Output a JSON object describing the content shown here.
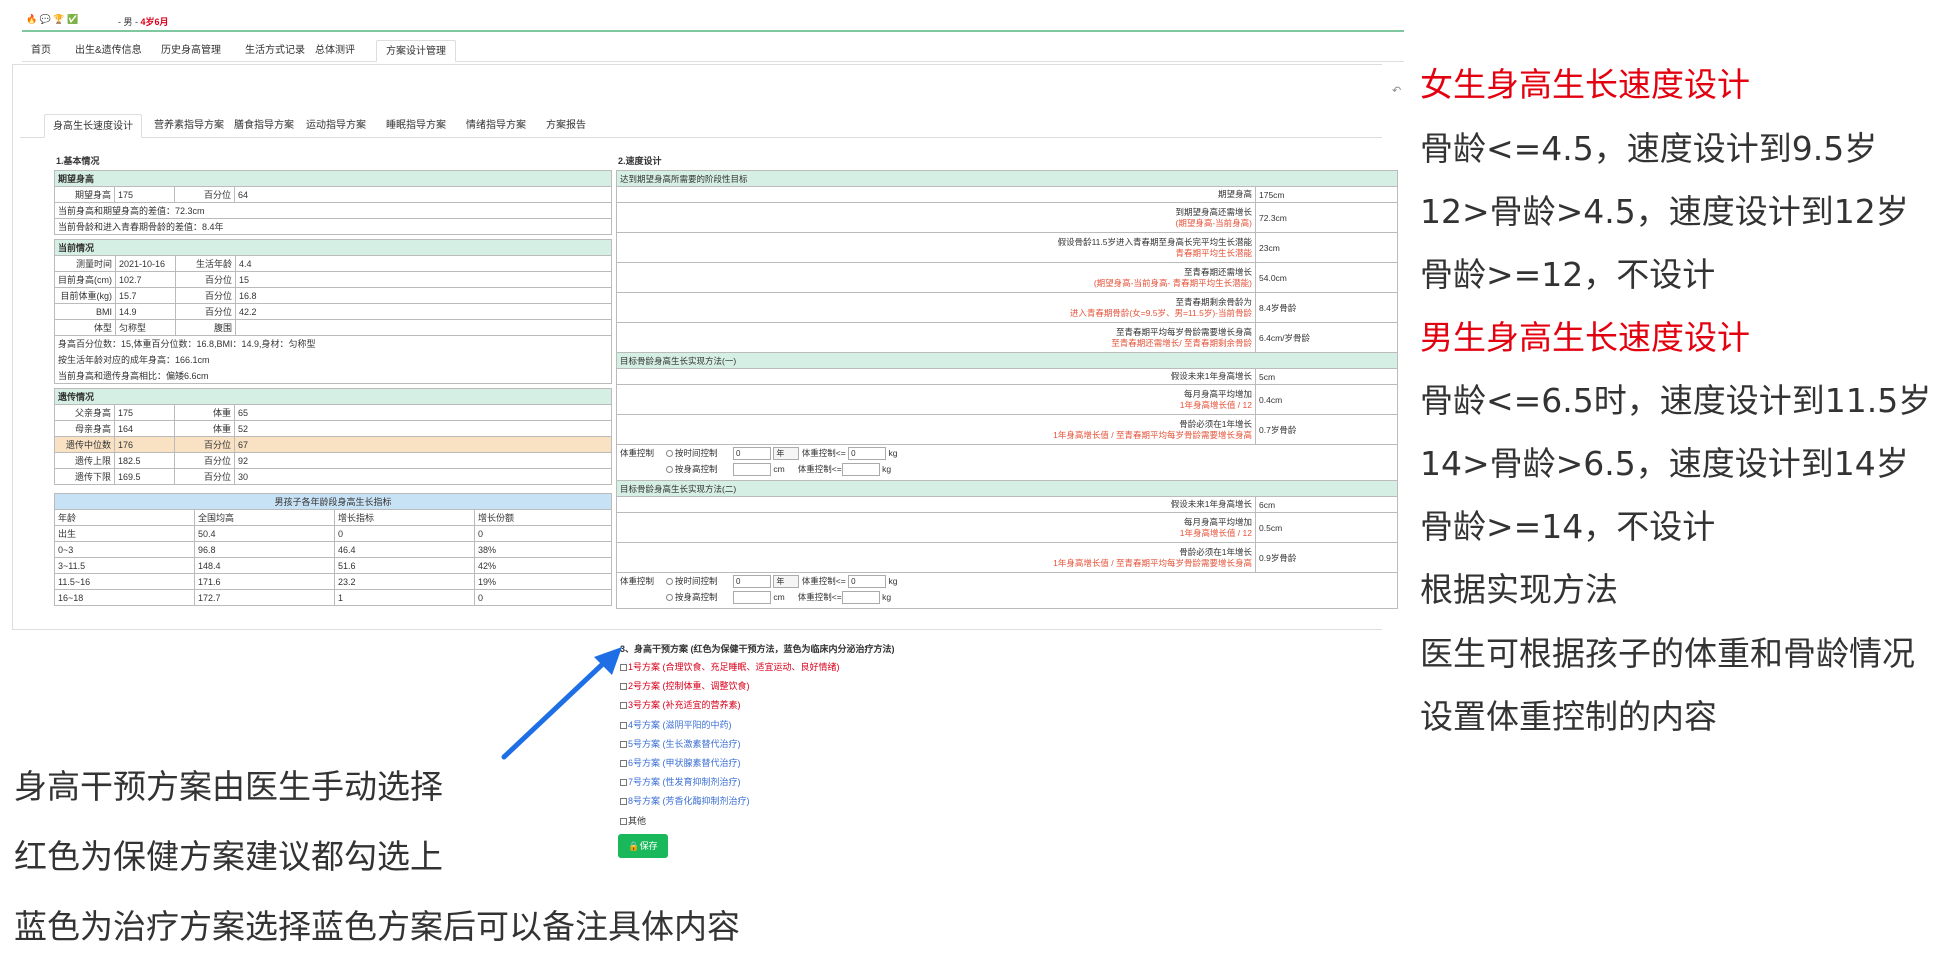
{
  "header": {
    "icons": "🔥 💬 🏆 ✅",
    "title": "- 男 -",
    "age": "4岁6月"
  },
  "main_tabs": [
    "首页",
    "出生&遗传信息",
    "历史身高管理",
    "生活方式记录",
    "总体测评",
    "方案设计管理"
  ],
  "sub_tabs": [
    "身高生长速度设计",
    "营养素指导方案",
    "膳食指导方案",
    "运动指导方案",
    "睡眠指导方案",
    "情绪指导方案",
    "方案报告"
  ],
  "left": {
    "section_title": "1.基本情况",
    "expect": {
      "hd": "期望身高",
      "height_label": "期望身高",
      "height_val": "175",
      "pct_label": "百分位",
      "pct_val": "64",
      "line1": "当前身高和期望身高的差值：72.3cm",
      "line2": "当前骨龄和进入青春期骨龄的差值：8.4年"
    },
    "current": {
      "hd": "当前情况",
      "rows": [
        [
          "测量时间",
          "2021-10-16",
          "生活年龄",
          "4.4"
        ],
        [
          "目前身高(cm)",
          "102.7",
          "百分位",
          "15"
        ],
        [
          "目前体重(kg)",
          "15.7",
          "百分位",
          "16.8"
        ],
        [
          "BMI",
          "14.9",
          "百分位",
          "42.2"
        ],
        [
          "体型",
          "匀称型",
          "腹围",
          ""
        ]
      ],
      "line1": "身高百分位数：15,体重百分位数：16.8,BMI：14.9,身材：匀称型",
      "line2": "按生活年龄对应的成年身高：166.1cm",
      "line3": "当前身高和遗传身高相比：偏矮6.6cm"
    },
    "genetic": {
      "hd": "遗传情况",
      "rows": [
        [
          "父亲身高",
          "175",
          "体重",
          "65"
        ],
        [
          "母亲身高",
          "164",
          "体重",
          "52"
        ],
        [
          "遗传中位数",
          "176",
          "百分位",
          "67"
        ],
        [
          "遗传上限",
          "182.5",
          "百分位",
          "92"
        ],
        [
          "遗传下限",
          "169.5",
          "百分位",
          "30"
        ]
      ]
    },
    "growth": {
      "hd": "男孩子各年龄段身高生长指标",
      "cols": [
        "年龄",
        "全国均高",
        "增长指标",
        "增长份额"
      ],
      "rows": [
        [
          "出生",
          "50.4",
          "0",
          "0"
        ],
        [
          "0~3",
          "96.8",
          "46.4",
          "38%"
        ],
        [
          "3~11.5",
          "148.4",
          "51.6",
          "42%"
        ],
        [
          "11.5~16",
          "171.6",
          "23.2",
          "19%"
        ],
        [
          "16~18",
          "172.7",
          "1",
          "0"
        ]
      ]
    }
  },
  "right": {
    "section_title": "2.速度设计",
    "stage_hd": "达到期望身高所需要的阶段性目标",
    "stage_rows": [
      {
        "l": "期望身高",
        "n": "",
        "v": "175cm"
      },
      {
        "l": "到期望身高还需增长",
        "n": "(期望身高-当前身高)",
        "v": "72.3cm"
      },
      {
        "l": "假设骨龄11.5岁进入青春期至身高长完平均生长潜能",
        "n": "青春期平均生长潜能",
        "v": "23cm"
      },
      {
        "l": "至青春期还需增长",
        "n": "(期望身高-当前身高- 青春期平均生长潜能)",
        "v": "54.0cm"
      },
      {
        "l": "至青春期剩余骨龄为",
        "n": "进入青春期骨龄(女=9.5岁、男=11.5岁)-当前骨龄",
        "v": "8.4岁骨龄"
      },
      {
        "l": "至青春期平均每岁骨龄需要增长身高",
        "n": "至青春期还需增长/ 至青春期剩余骨龄",
        "v": "6.4cm/岁骨龄"
      }
    ],
    "m1_hd": "目标骨龄身高生长实现方法(一)",
    "m1_rows": [
      {
        "l": "假设未来1年身高增长",
        "n": "",
        "v": "5cm"
      },
      {
        "l": "每月身高平均增加",
        "n": "1年身高增长值 / 12",
        "v": "0.4cm"
      },
      {
        "l": "骨龄必须在1年增长",
        "n": "1年身高增长值 / 至青春期平均每岁骨龄需要增长身高",
        "v": "0.7岁骨龄"
      }
    ],
    "m2_hd": "目标骨龄身高生长实现方法(二)",
    "m2_rows": [
      {
        "l": "假设未来1年身高增长",
        "n": "",
        "v": "6cm"
      },
      {
        "l": "每月身高平均增加",
        "n": "1年身高增长值 / 12",
        "v": "0.5cm"
      },
      {
        "l": "骨龄必须在1年增长",
        "n": "1年身高增长值 / 至青春期平均每岁骨龄需要增长身高",
        "v": "0.9岁骨龄"
      }
    ],
    "wc": {
      "label": "体重控制",
      "opt1": "按时间控制",
      "opt2": "按身高控制",
      "v": "0",
      "unit_sel": "年",
      "kg_label": "体重控制<=",
      "kg": "kg",
      "cm": "cm"
    }
  },
  "plans": {
    "title": "3、身高干预方案 (红色为保健干预方法，蓝色为临床内分泌治疗方法)",
    "items": [
      {
        "t": "1号方案 (合理饮食、充足睡眠、适宜运动、良好情绪)",
        "c": "red"
      },
      {
        "t": "2号方案 (控制体重、调整饮食)",
        "c": "red"
      },
      {
        "t": "3号方案 (补充适宜的营养素)",
        "c": "red"
      },
      {
        "t": "4号方案 (滋阴平阳的中药)",
        "c": "blue"
      },
      {
        "t": "5号方案 (生长激素替代治疗)",
        "c": "blue"
      },
      {
        "t": "6号方案 (甲状腺素替代治疗)",
        "c": "blue"
      },
      {
        "t": "7号方案 (性发育抑制剂治疗)",
        "c": "blue"
      },
      {
        "t": "8号方案 (芳香化酶抑制剂治疗)",
        "c": "blue"
      },
      {
        "t": "其他",
        "c": "dark"
      }
    ],
    "save": "🔒保存"
  },
  "annotations": {
    "right": [
      {
        "t": "女生身高生长速度设计",
        "red": true
      },
      {
        "t": "骨龄<=4.5，速度设计到9.5岁",
        "red": false
      },
      {
        "t": "12>骨龄>4.5，速度设计到12岁",
        "red": false
      },
      {
        "t": "骨龄>=12，不设计",
        "red": false
      },
      {
        "t": "男生身高生长速度设计",
        "red": true
      },
      {
        "t": "骨龄<=6.5时，速度设计到11.5岁",
        "red": false
      },
      {
        "t": "14>骨龄>6.5，速度设计到14岁",
        "red": false
      },
      {
        "t": "骨龄>=14，不设计",
        "red": false
      },
      {
        "t": "根据实现方法",
        "red": false
      },
      {
        "t": "医生可根据孩子的体重和骨龄情况",
        "red": false
      },
      {
        "t": "设置体重控制的内容",
        "red": false
      }
    ],
    "left": [
      "身高干预方案由医生手动选择",
      "红色为保健方案建议都勾选上",
      "蓝色为治疗方案选择蓝色方案后可以备注具体内容"
    ]
  }
}
